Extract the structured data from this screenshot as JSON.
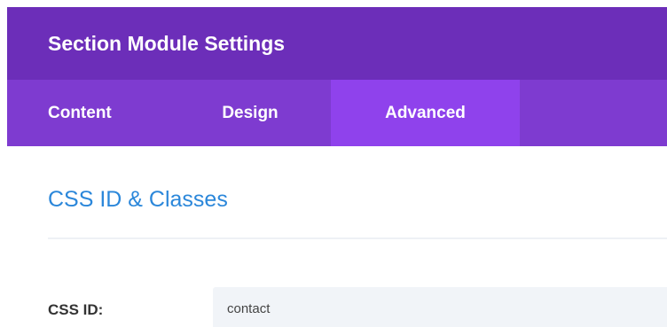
{
  "header": {
    "title": "Section Module Settings"
  },
  "tabs": [
    {
      "label": "Content",
      "active": false
    },
    {
      "label": "Design",
      "active": false
    },
    {
      "label": "Advanced",
      "active": true
    }
  ],
  "section": {
    "heading": "CSS ID & Classes"
  },
  "fields": {
    "css_id": {
      "label": "CSS ID:",
      "value": "contact"
    }
  },
  "colors": {
    "header_bg": "#6c2eb9",
    "tabs_bg": "#7e3bd0",
    "active_tab_bg": "#8f42ec",
    "heading_blue": "#2b87da"
  }
}
